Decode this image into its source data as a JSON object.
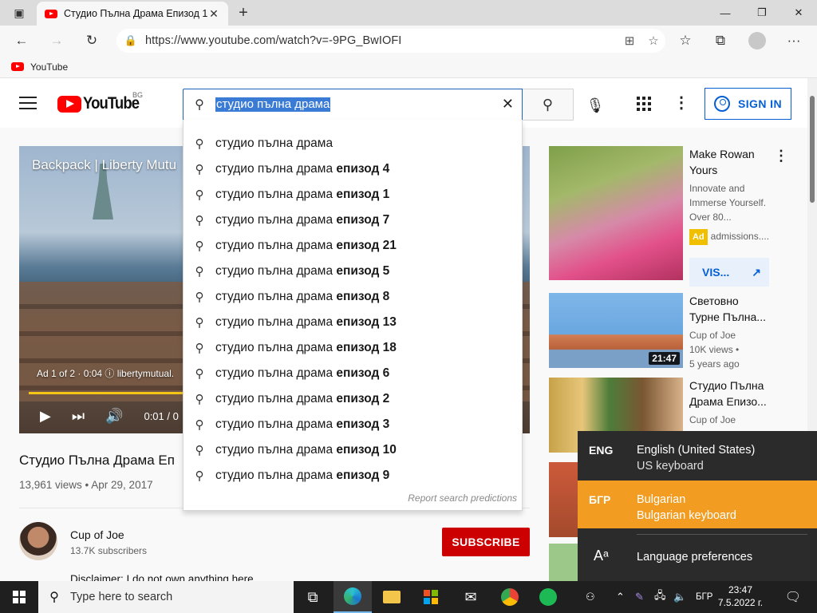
{
  "browser": {
    "tab_title": "Студио Пълна Драма Епизод 1",
    "url": "https://www.youtube.com/watch?v=-9PG_BwIOFI",
    "bookmark_label": "YouTube"
  },
  "youtube": {
    "region": "BG",
    "logo_text": "YouTube",
    "search_value": "студио пълна драма",
    "sign_in": "SIGN IN",
    "suggestions": [
      {
        "base": "студио пълна драма",
        "bold": ""
      },
      {
        "base": "студио пълна драма ",
        "bold": "епизод 4"
      },
      {
        "base": "студио пълна драма ",
        "bold": "епизод 1"
      },
      {
        "base": "студио пълна драма ",
        "bold": "епизод 7"
      },
      {
        "base": "студио пълна драма ",
        "bold": "епизод 21"
      },
      {
        "base": "студио пълна драма ",
        "bold": "епизод 5"
      },
      {
        "base": "студио пълна драма ",
        "bold": "епизод 8"
      },
      {
        "base": "студио пълна драма ",
        "bold": "епизод 13"
      },
      {
        "base": "студио пълна драма ",
        "bold": "епизод 18"
      },
      {
        "base": "студио пълна драма ",
        "bold": "епизод 6"
      },
      {
        "base": "студио пълна драма ",
        "bold": "епизод 2"
      },
      {
        "base": "студио пълна драма ",
        "bold": "епизод 3"
      },
      {
        "base": "студио пълна драма ",
        "bold": "епизод 10"
      },
      {
        "base": "студио пълна драма ",
        "bold": "епизод 9"
      }
    ],
    "report_predictions": "Report search predictions",
    "player": {
      "ad_title": "Backpack | Liberty Mutu",
      "ad_info": "Ad 1 of 2 · 0:04  ⓘ  libertymutual.",
      "time": "0:01 / 0",
      "progress": 0.33
    },
    "video": {
      "title": "Студио Пълна Драма Еп",
      "meta": "13,961 views • Apr 29, 2017",
      "channel": "Cup of Joe",
      "subscribers": "13.7K subscribers",
      "subscribe": "SUBSCRIBE",
      "disclaimer": "Disclaimer: I do not own anything here"
    },
    "sidebar": [
      {
        "title_line1": "Make Rowan",
        "title_line2": "Yours",
        "sub1": "Innovate and",
        "sub2": "Immerse Yourself.",
        "sub3": "Over 80...",
        "ad_badge": "Ad",
        "ad_domain": "admissions....",
        "visit": "VIS..."
      },
      {
        "title_line1": "Световно",
        "title_line2": "Турне Пълна...",
        "channel": "Cup of Joe",
        "views": "10K views •",
        "age": "5 years ago",
        "duration": "21:47"
      },
      {
        "title_line1": "Студио Пълна",
        "title_line2": "Драма Епизо...",
        "channel": "Cup of Joe"
      }
    ]
  },
  "language_flyout": {
    "items": [
      {
        "code": "ENG",
        "line1": "English (United States)",
        "line2": "US keyboard"
      },
      {
        "code": "БГР",
        "line1": "Bulgarian",
        "line2": "Bulgarian keyboard"
      }
    ],
    "preferences": "Language preferences",
    "accent": "#f29c22"
  },
  "taskbar": {
    "search_placeholder": "Type here to search",
    "lang_indicator": "БГР",
    "time": "23:47",
    "date": "7.5.2022 г."
  }
}
